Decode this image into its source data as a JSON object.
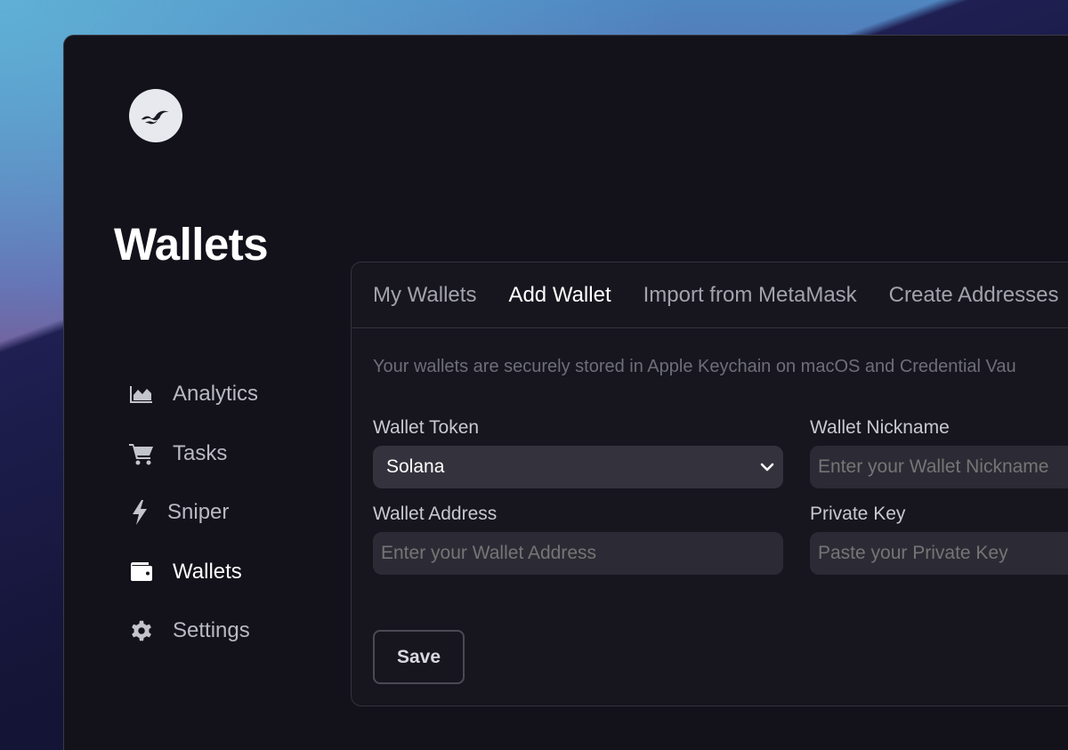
{
  "app": {
    "logo_icon": "wave-logo-icon",
    "page_title": "Wallets"
  },
  "sidebar": {
    "items": [
      {
        "label": "Analytics",
        "icon": "area-chart-icon",
        "active": false
      },
      {
        "label": "Tasks",
        "icon": "cart-icon",
        "active": false
      },
      {
        "label": "Sniper",
        "icon": "lightning-icon",
        "active": false
      },
      {
        "label": "Wallets",
        "icon": "wallet-icon",
        "active": true
      },
      {
        "label": "Settings",
        "icon": "gear-icon",
        "active": false
      }
    ]
  },
  "panel": {
    "tabs": [
      {
        "label": "My Wallets",
        "active": false
      },
      {
        "label": "Add Wallet",
        "active": true
      },
      {
        "label": "Import from MetaMask",
        "active": false
      },
      {
        "label": "Create Addresses",
        "active": false
      }
    ],
    "notice": "Your wallets are securely stored in Apple Keychain on macOS and Credential Vau",
    "form": {
      "token_label": "Wallet Token",
      "token_value": "Solana",
      "nickname_label": "Wallet Nickname",
      "nickname_placeholder": "Enter your Wallet Nickname",
      "address_label": "Wallet Address",
      "address_placeholder": "Enter your Wallet Address",
      "private_key_label": "Private Key",
      "private_key_placeholder": "Paste your Private Key"
    },
    "save_label": "Save"
  },
  "colors": {
    "window_bg": "#13121b",
    "panel_bg": "#17161f",
    "input_bg": "#2c2b35",
    "text_active": "#ffffff",
    "text_muted": "#a2a2ab"
  }
}
